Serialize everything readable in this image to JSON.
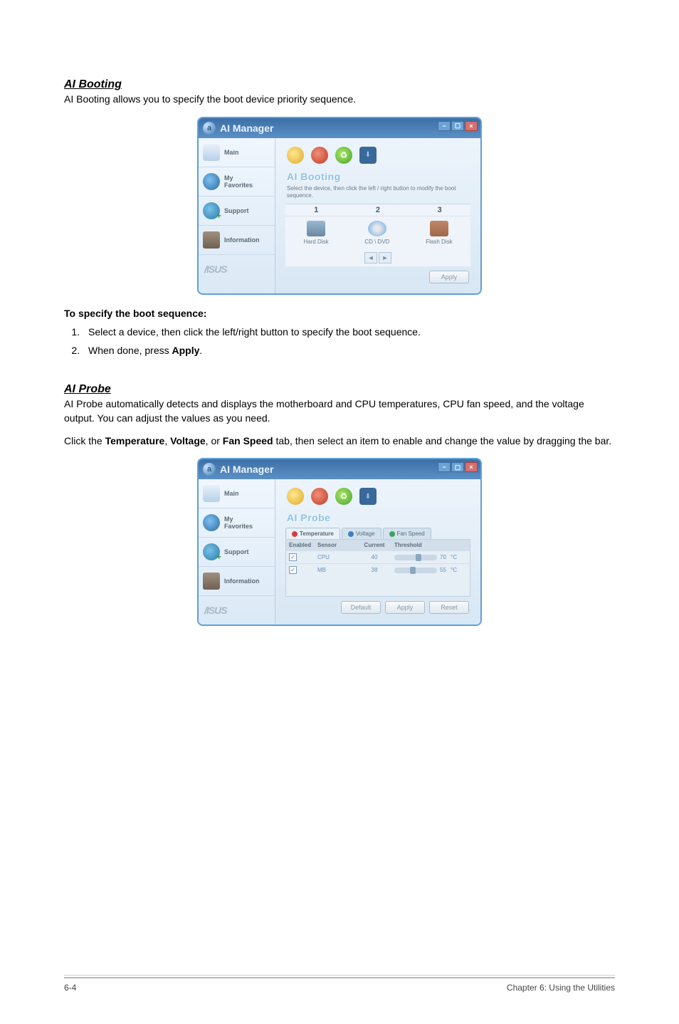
{
  "section1": {
    "title": "AI Booting",
    "intro": "AI Booting allows you to specify the boot device priority sequence.",
    "subheading": "To specify the boot sequence:",
    "steps": [
      "Select a device, then click the left/right button to specify the boot sequence.",
      "When done, press "
    ],
    "step2_bold": "Apply",
    "step2_after": "."
  },
  "section2": {
    "title": "AI Probe",
    "intro": "AI Probe automatically detects and displays the motherboard and CPU temperatures, CPU fan speed, and the voltage output. You can adjust the values as you need.",
    "instruction_pre": "Click the ",
    "instruction_b1": "Temperature",
    "instruction_mid1": ", ",
    "instruction_b2": "Voltage",
    "instruction_mid2": ", or ",
    "instruction_b3": "Fan Speed",
    "instruction_post": " tab, then select an item to enable and change the value by dragging the bar."
  },
  "app": {
    "title": "AI Manager",
    "sidebar": {
      "main": "Main",
      "fav": "My\nFavorites",
      "support": "Support",
      "info": "Information",
      "brand": "/ISUS"
    }
  },
  "boot_panel": {
    "title": "AI Booting",
    "desc": "Select the device, then click the left / right button to modify the boot sequence.",
    "nums": [
      "1",
      "2",
      "3"
    ],
    "devices": [
      "Hard Disk",
      "CD \\ DVD",
      "Flash Disk"
    ],
    "apply": "Apply"
  },
  "probe_panel": {
    "title": "AI Probe",
    "tabs": [
      "Temperature",
      "Voltage",
      "Fan Speed"
    ],
    "headers": {
      "enabled": "Enabled",
      "sensor": "Sensor",
      "current": "Current",
      "threshold": "Threshold"
    },
    "rows": [
      {
        "sensor": "CPU",
        "current": "40",
        "threshold": "70",
        "unit": "°C"
      },
      {
        "sensor": "MB",
        "current": "38",
        "threshold": "55",
        "unit": "°C"
      }
    ],
    "buttons": {
      "default": "Default",
      "apply": "Apply",
      "reset": "Reset"
    }
  },
  "chart_data": {
    "type": "table",
    "title": "AI Probe Temperature",
    "columns": [
      "Sensor",
      "Current (°C)",
      "Threshold (°C)"
    ],
    "rows": [
      [
        "CPU",
        40,
        70
      ],
      [
        "MB",
        38,
        55
      ]
    ]
  },
  "footer": {
    "left": "6-4",
    "right": "Chapter 6: Using the Utilities"
  }
}
